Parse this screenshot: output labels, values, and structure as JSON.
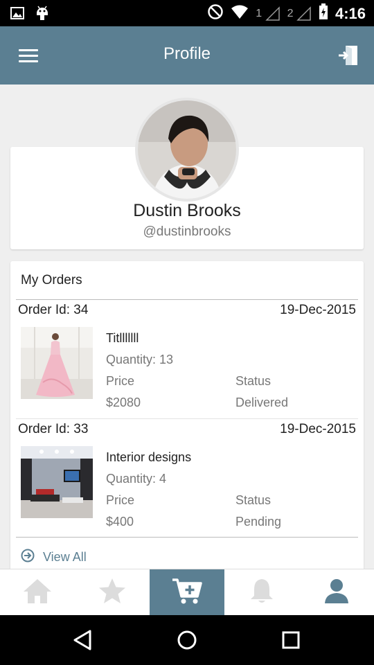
{
  "status_bar": {
    "sim1": "1",
    "sim2": "2",
    "time": "4:16",
    "icons": [
      "image-icon",
      "android-icon",
      "do-not-disturb-icon",
      "wifi-icon",
      "signal-icon",
      "battery-icon"
    ]
  },
  "app_bar": {
    "title": "Profile",
    "menu_icon": "menu-icon",
    "logout_icon": "logout-icon"
  },
  "profile": {
    "name": "Dustin Brooks",
    "handle": "@dustinbrooks"
  },
  "orders": {
    "title": "My Orders",
    "price_label": "Price",
    "status_label": "Status",
    "items": [
      {
        "order_id": "Order Id: 34",
        "date": "19-Dec-2015",
        "name": "Titlllllll",
        "quantity": "Quantity: 13",
        "price": "$2080",
        "status": "Delivered"
      },
      {
        "order_id": "Order Id: 33",
        "date": "19-Dec-2015",
        "name": "Interior designs",
        "quantity": "Quantity: 4",
        "price": "$400",
        "status": "Pending"
      }
    ],
    "view_all": "View All"
  },
  "bottom_nav": {
    "tabs": [
      "home-icon",
      "star-icon",
      "cart-add-icon",
      "bell-icon",
      "person-icon"
    ],
    "active_tab": "cart-add-icon"
  },
  "colors": {
    "primary": "#5b7f92",
    "inactive_icon": "#dcdcdc",
    "active_user_icon": "#5b7f92"
  }
}
